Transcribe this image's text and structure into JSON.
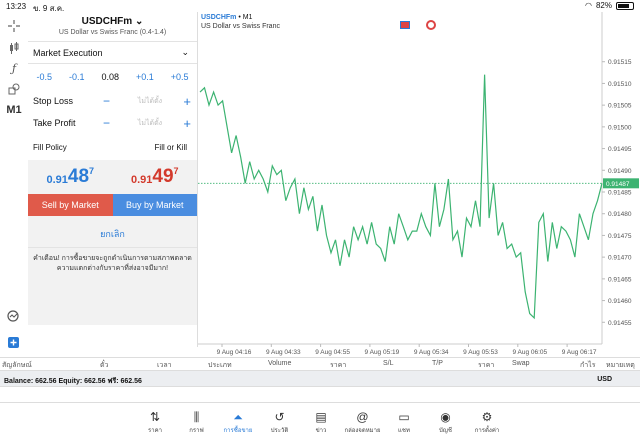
{
  "status_bar": {
    "time": "13:23",
    "date": "ข. 9 ส.ค.",
    "battery": "82%"
  },
  "order": {
    "symbol": "USDCHFm",
    "symbol_desc": "US Dollar vs Swiss Franc (0.4-1.4)",
    "execution": "Market Execution",
    "volume_steps": [
      "-0.5",
      "-0.1",
      "0.08",
      "+0.1",
      "+0.5"
    ],
    "stop_loss_label": "Stop Loss",
    "take_profit_label": "Take Profit",
    "not_set": "ไม่ได้ตั้ง",
    "minus": "−",
    "plus": "+",
    "fill_policy_label": "Fill Policy",
    "fill_policy_value": "Fill or Kill",
    "bid": {
      "main": "0.91",
      "big": "48",
      "sup": "7"
    },
    "ask": {
      "main": "0.91",
      "big": "49",
      "sup": "7"
    },
    "sell_label": "Sell by Market",
    "buy_label": "Buy by Market",
    "cancel_label": "ยกเลิก",
    "warning_1": "คำเตือน! การซื้อขายจะถูกดำเนินการตามสภาพตลาด",
    "warning_2": "ความแตกต่างกับราคาที่ส่งอาจมีมาก!"
  },
  "chart": {
    "title_symbol": "USDCHFm",
    "title_tf": " • M1",
    "subtitle": "US Dollar vs Swiss Franc",
    "current_price_label": "0.91487",
    "line_color": "#3cb371",
    "current_line_color": "#3cb371"
  },
  "chart_data": {
    "type": "line",
    "y_ticks": [
      "0.91515",
      "0.91510",
      "0.91505",
      "0.91500",
      "0.91495",
      "0.91490",
      "0.91485",
      "0.91480",
      "0.91475",
      "0.91470",
      "0.91465",
      "0.91460",
      "0.91455"
    ],
    "x_ticks": [
      "9 Aug 04:16",
      "9 Aug 04:33",
      "9 Aug 04:55",
      "9 Aug 05:19",
      "9 Aug 05:34",
      "9 Aug 05:53",
      "9 Aug 06:05",
      "9 Aug 06:17"
    ],
    "ylim": [
      0.9145,
      0.9152
    ],
    "current": 0.91487,
    "values": [
      0.91508,
      0.91509,
      0.91505,
      0.91508,
      0.91505,
      0.91506,
      0.915,
      0.91494,
      0.91498,
      0.91493,
      0.91487,
      0.91492,
      0.91488,
      0.9149,
      0.91488,
      0.91485,
      0.91491,
      0.91489,
      0.9149,
      0.91483,
      0.91486,
      0.91488,
      0.9148,
      0.91486,
      0.91481,
      0.91484,
      0.91476,
      0.91482,
      0.91475,
      0.91471,
      0.91474,
      0.91468,
      0.91474,
      0.9147,
      0.91477,
      0.91474,
      0.91477,
      0.91473,
      0.91478,
      0.91473,
      0.91472,
      0.91469,
      0.91477,
      0.91473,
      0.9148,
      0.91477,
      0.91474,
      0.91476,
      0.91476,
      0.9148,
      0.91477,
      0.91475,
      0.91487,
      0.91477,
      0.91481,
      0.91488,
      0.91474,
      0.91476,
      0.9147,
      0.91479,
      0.91477,
      0.91483,
      0.91477,
      0.91512,
      0.91479,
      0.91487,
      0.91475,
      0.91478,
      0.91472,
      0.91473,
      0.9147,
      0.91471,
      0.91462,
      0.91457,
      0.91456,
      0.91478,
      0.9148,
      0.91469,
      0.91478,
      0.91472,
      0.91477,
      0.91476,
      0.91474,
      0.9147,
      0.9148,
      0.91477,
      0.91474,
      0.9148,
      0.91483,
      0.91487
    ]
  },
  "left_tools": [
    "crosshair-icon",
    "candles-icon",
    "function-icon",
    "objects-icon"
  ],
  "timeframe": "M1",
  "trade_columns": [
    "สัญลักษณ์",
    "ตั๋ว",
    "เวลา",
    "ประเภท",
    "Volume",
    "ราคา",
    "S/L",
    "T/P",
    "ราคา",
    "Swap",
    "กำไร",
    "หมายเหตุ"
  ],
  "balance": {
    "text": "Balance: 662.56  Equity: 662.56  ฟรี: 662.56",
    "currency": "USD"
  },
  "tabs": [
    {
      "label": "ราคา",
      "icon": "⇅"
    },
    {
      "label": "กราฟ",
      "icon": "⫼"
    },
    {
      "label": "การซื้อขาย",
      "icon": "⏶",
      "active": true
    },
    {
      "label": "ประวัติ",
      "icon": "↺"
    },
    {
      "label": "ข่าว",
      "icon": "▤"
    },
    {
      "label": "กล่องจดหมาย",
      "icon": "@"
    },
    {
      "label": "แชท",
      "icon": "▭"
    },
    {
      "label": "บัญชี",
      "icon": "◉"
    },
    {
      "label": "การตั้งค่า",
      "icon": "⚙"
    }
  ]
}
